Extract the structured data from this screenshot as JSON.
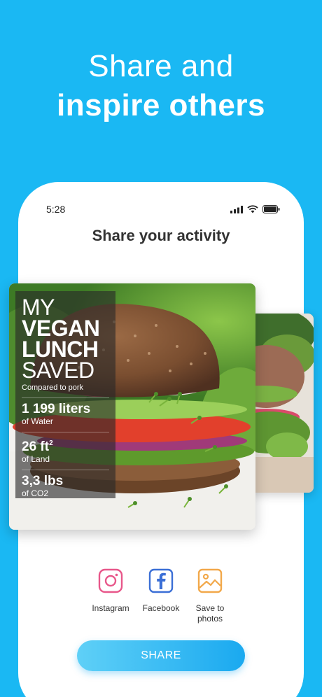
{
  "headline": {
    "line1": "Share and",
    "line2": "inspire others"
  },
  "status": {
    "time": "5:28"
  },
  "screen": {
    "title": "Share your activity"
  },
  "card": {
    "title_my": "MY",
    "title_vegan": "VEGAN",
    "title_lunch": "LUNCH",
    "title_saved": "SAVED",
    "compared": "Compared to pork",
    "stats": [
      {
        "value": "1 199 liters",
        "unit": "of Water"
      },
      {
        "value": "26 ft",
        "sup": "2",
        "unit": "of Land"
      },
      {
        "value": "3,3 lbs",
        "unit": "of CO2"
      }
    ]
  },
  "share_options": [
    {
      "label": "Instagram",
      "icon": "instagram-icon",
      "color": "#e8578a"
    },
    {
      "label": "Facebook",
      "icon": "facebook-icon",
      "color": "#3b6fd6"
    },
    {
      "label": "Save to photos",
      "icon": "photos-icon",
      "color": "#f2a84a"
    }
  ],
  "share_button": {
    "label": "SHARE"
  },
  "colors": {
    "background": "#1ab8f3",
    "accent": "#1aa9f0"
  }
}
